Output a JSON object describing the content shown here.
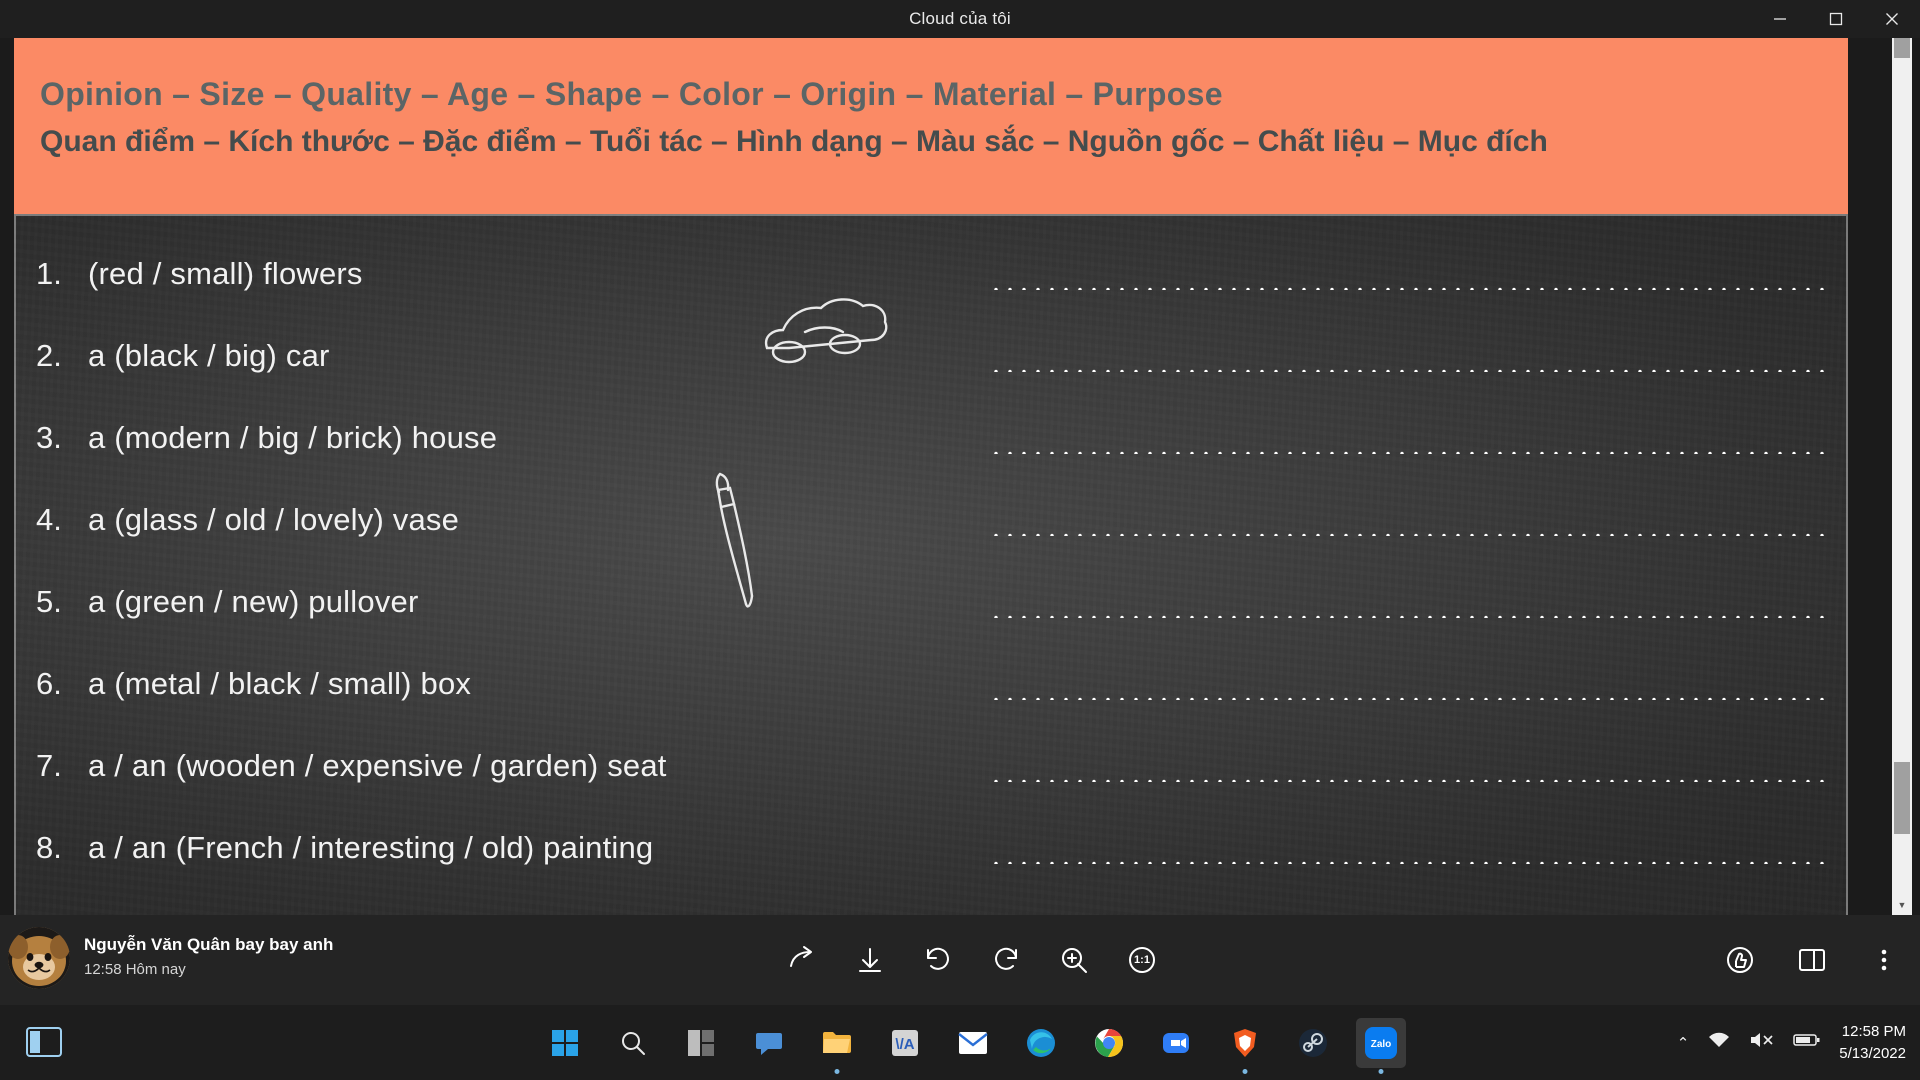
{
  "window": {
    "title": "Cloud của tôi",
    "controls": {
      "minimize": "minimize-icon",
      "maximize": "maximize-icon",
      "close": "close-icon"
    }
  },
  "slide": {
    "header": {
      "english_order": [
        "Opinion",
        "–",
        "Size",
        "–",
        "Quality",
        "–",
        "Age",
        "–",
        "Shape",
        "–",
        "Color",
        "–",
        "Origin",
        "– Material –",
        "Purpose"
      ],
      "english_line": "Opinion –    Size    – Quality –   Age   –  Shape   –  Color  –  Origin   – Material – Purpose",
      "vietnamese_line": "Quan điểm – Kích thước – Đặc điểm – Tuổi tác – Hình dạng – Màu sắc – Nguồn gốc – Chất liệu – Mục đích",
      "background_color": "#fb8a65",
      "text_color": "#5b6566"
    },
    "exercises": [
      {
        "num": "1.",
        "text": "(red / small) flowers"
      },
      {
        "num": "2.",
        "text": "a (black / big) car"
      },
      {
        "num": "3.",
        "text": "a (modern / big / brick) house"
      },
      {
        "num": "4.",
        "text": "a (glass / old / lovely) vase"
      },
      {
        "num": "5.",
        "text": "a (green / new) pullover"
      },
      {
        "num": "6.",
        "text": "a (metal / black / small) box"
      },
      {
        "num": "7.",
        "text": "a / an (wooden / expensive / garden) seat"
      },
      {
        "num": "8.",
        "text": "a / an (French / interesting / old) painting"
      }
    ],
    "doodles": [
      "car-doodle",
      "paintbrush-doodle"
    ]
  },
  "bottom_bar": {
    "sender_name": "Nguyễn Văn Quân bay bay anh",
    "sender_time": "12:58 Hôm nay",
    "tools": [
      {
        "name": "share-icon"
      },
      {
        "name": "download-icon"
      },
      {
        "name": "rotate-left-icon"
      },
      {
        "name": "rotate-right-icon"
      },
      {
        "name": "zoom-in-icon"
      },
      {
        "name": "actual-size-icon",
        "label": "1:1"
      }
    ],
    "right_tools": [
      {
        "name": "thumbs-up-icon"
      },
      {
        "name": "split-view-icon"
      },
      {
        "name": "more-options-icon"
      }
    ]
  },
  "taskbar": {
    "left_icon": "task-view-icon",
    "items": [
      {
        "name": "start-icon"
      },
      {
        "name": "search-icon"
      },
      {
        "name": "widgets-icon"
      },
      {
        "name": "chat-icon"
      },
      {
        "name": "file-explorer-icon"
      },
      {
        "name": "unikey-icon",
        "label": "\\/A"
      },
      {
        "name": "mail-icon"
      },
      {
        "name": "microsoft-edge-icon"
      },
      {
        "name": "google-chrome-icon"
      },
      {
        "name": "zoom-app-icon"
      },
      {
        "name": "brave-browser-icon"
      },
      {
        "name": "steam-icon"
      },
      {
        "name": "zalo-icon",
        "label": "Zalo"
      }
    ],
    "tray": [
      {
        "name": "show-hidden-icons-chevron"
      },
      {
        "name": "wifi-icon"
      },
      {
        "name": "volume-muted-icon"
      },
      {
        "name": "battery-icon"
      }
    ],
    "clock_time": "12:58 PM",
    "clock_date": "5/13/2022"
  }
}
